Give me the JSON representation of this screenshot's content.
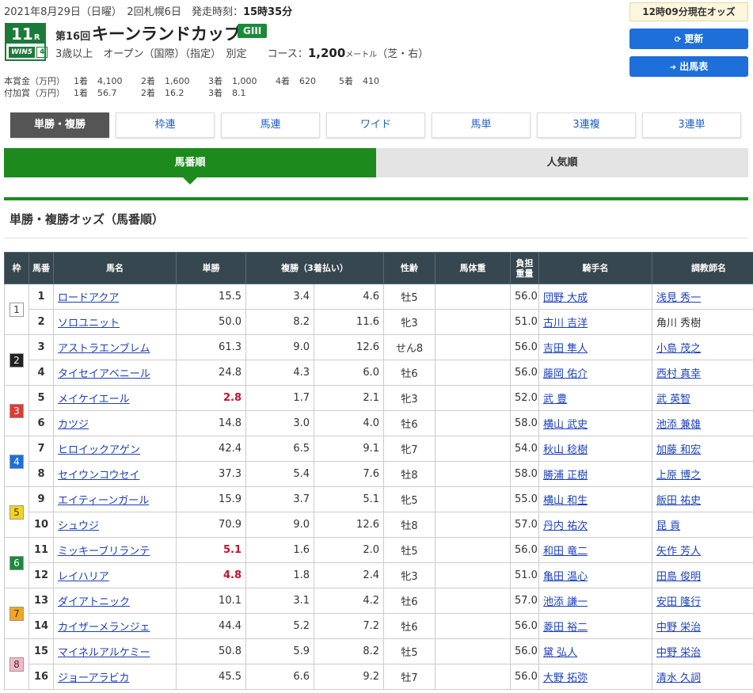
{
  "header": {
    "date_line": "2021年8月29日（日曜）　2回札幌6日　発走時刻：",
    "post_time": "15時35分",
    "race_no": "11",
    "race_no_suffix": "R",
    "win5_label": "WIN5",
    "win5_no": "4",
    "kai": "第16回",
    "race_name": "キーンランドカップ",
    "grade": "GIII",
    "conditions": "3歳以上　オープン（国際）（指定）　別定　　コース：",
    "course_distance": "1,200",
    "course_unit": "メートル",
    "course_detail": "（芝・右）"
  },
  "prize": {
    "main": [
      "本賞金（万円）",
      "1着",
      "4,100",
      "2着",
      "1,600",
      "3着",
      "1,000",
      "4着",
      "620",
      "5着",
      "410"
    ],
    "added": [
      "付加賞（万円）",
      "1着",
      "56.7",
      "2着",
      "16.2",
      "3着",
      "8.1"
    ]
  },
  "right": {
    "odds_time": "12時09分現在オッズ",
    "refresh_label": "更新",
    "refresh_icon": "refresh-icon",
    "entries_label": "出馬表",
    "entries_icon": "arrow-circle-right-icon"
  },
  "tabs": [
    "単勝・複勝",
    "枠連",
    "馬連",
    "ワイド",
    "馬単",
    "3連複",
    "3連単"
  ],
  "segment": {
    "left": "馬番順",
    "right": "人気順"
  },
  "section_title": "単勝・複勝オッズ（馬番順）",
  "table": {
    "headers": {
      "waku": "枠",
      "umaban": "馬番",
      "name": "馬名",
      "win": "単勝",
      "place": "複勝（3着払い）",
      "sex_age": "性齢",
      "weight": "馬体重",
      "burden_1": "負担",
      "burden_2": "重量",
      "jockey": "騎手名",
      "trainer": "調教師名"
    },
    "rows": [
      {
        "waku": "1",
        "umaban": "1",
        "name": "ロードアクア",
        "win": "15.5",
        "pmin": "3.4",
        "pmax": "4.6",
        "sexage": "牡5",
        "burden": "56.0",
        "jockey": "団野 大成",
        "trainer": "浅見 秀一"
      },
      {
        "waku": "",
        "umaban": "2",
        "name": "ソロユニット",
        "win": "50.0",
        "pmin": "8.2",
        "pmax": "11.6",
        "sexage": "牝3",
        "burden": "51.0",
        "jockey": "古川 吉洋",
        "trainer": "角川 秀樹"
      },
      {
        "waku": "2",
        "umaban": "3",
        "name": "アストラエンブレム",
        "win": "61.3",
        "pmin": "9.0",
        "pmax": "12.6",
        "sexage": "せん8",
        "burden": "56.0",
        "jockey": "吉田 隼人",
        "trainer": "小島 茂之"
      },
      {
        "waku": "",
        "umaban": "4",
        "name": "タイセイアベニール",
        "win": "24.8",
        "pmin": "4.3",
        "pmax": "6.0",
        "sexage": "牡6",
        "burden": "56.0",
        "jockey": "藤岡 佑介",
        "trainer": "西村 真幸"
      },
      {
        "waku": "3",
        "umaban": "5",
        "name": "メイケイエール",
        "win": "2.8",
        "pmin": "1.7",
        "pmax": "2.1",
        "sexage": "牝3",
        "burden": "52.0",
        "jockey": "武 豊",
        "trainer": "武 英智"
      },
      {
        "waku": "",
        "umaban": "6",
        "name": "カツジ",
        "win": "14.8",
        "pmin": "3.0",
        "pmax": "4.0",
        "sexage": "牡6",
        "burden": "58.0",
        "jockey": "横山 武史",
        "trainer": "池添 兼雄"
      },
      {
        "waku": "4",
        "umaban": "7",
        "name": "ヒロイックアゲン",
        "win": "42.4",
        "pmin": "6.5",
        "pmax": "9.1",
        "sexage": "牝7",
        "burden": "54.0",
        "jockey": "秋山 稔樹",
        "trainer": "加藤 和宏"
      },
      {
        "waku": "",
        "umaban": "8",
        "name": "セイウンコウセイ",
        "win": "37.3",
        "pmin": "5.4",
        "pmax": "7.6",
        "sexage": "牡8",
        "burden": "58.0",
        "jockey": "勝浦 正樹",
        "trainer": "上原 博之"
      },
      {
        "waku": "5",
        "umaban": "9",
        "name": "エイティーンガール",
        "win": "15.9",
        "pmin": "3.7",
        "pmax": "5.1",
        "sexage": "牝5",
        "burden": "55.0",
        "jockey": "横山 和生",
        "trainer": "飯田 祐史"
      },
      {
        "waku": "",
        "umaban": "10",
        "name": "シュウジ",
        "win": "70.9",
        "pmin": "9.0",
        "pmax": "12.6",
        "sexage": "牡8",
        "burden": "57.0",
        "jockey": "丹内 祐次",
        "trainer": "昆 貢"
      },
      {
        "waku": "6",
        "umaban": "11",
        "name": "ミッキーブリランテ",
        "win": "5.1",
        "pmin": "1.6",
        "pmax": "2.0",
        "sexage": "牡5",
        "burden": "56.0",
        "jockey": "和田 竜二",
        "trainer": "矢作 芳人"
      },
      {
        "waku": "",
        "umaban": "12",
        "name": "レイハリア",
        "win": "4.8",
        "pmin": "1.8",
        "pmax": "2.4",
        "sexage": "牝3",
        "burden": "51.0",
        "jockey": "亀田 温心",
        "trainer": "田島 俊明"
      },
      {
        "waku": "7",
        "umaban": "13",
        "name": "ダイアトニック",
        "win": "10.1",
        "pmin": "3.1",
        "pmax": "4.2",
        "sexage": "牡6",
        "burden": "57.0",
        "jockey": "池添 謙一",
        "trainer": "安田 隆行"
      },
      {
        "waku": "",
        "umaban": "14",
        "name": "カイザーメランジェ",
        "win": "44.4",
        "pmin": "5.2",
        "pmax": "7.2",
        "sexage": "牡6",
        "burden": "56.0",
        "jockey": "菱田 裕二",
        "trainer": "中野 栄治"
      },
      {
        "waku": "8",
        "umaban": "15",
        "name": "マイネルアルケミー",
        "win": "50.8",
        "pmin": "5.9",
        "pmax": "8.2",
        "sexage": "牡5",
        "burden": "56.0",
        "jockey": "黛 弘人",
        "trainer": "中野 栄治"
      },
      {
        "waku": "",
        "umaban": "16",
        "name": "ジョーアラビカ",
        "win": "45.5",
        "pmin": "6.6",
        "pmax": "9.2",
        "sexage": "牡7",
        "burden": "56.0",
        "jockey": "大野 拓弥",
        "trainer": "清水 久詞"
      }
    ],
    "popular_wins": [
      "2.8",
      "5.1",
      "4.8"
    ],
    "plain_trainers": [
      "角川 秀樹"
    ],
    "waku_colors": {
      "1": {
        "bg": "#ffffff",
        "fg": "#333333"
      },
      "2": {
        "bg": "#222222",
        "fg": "#ffffff"
      },
      "3": {
        "bg": "#e03c31",
        "fg": "#ffffff"
      },
      "4": {
        "bg": "#1e6fd9",
        "fg": "#ffffff"
      },
      "5": {
        "bg": "#f7d31e",
        "fg": "#333333"
      },
      "6": {
        "bg": "#1d8a3a",
        "fg": "#ffffff"
      },
      "7": {
        "bg": "#f5a623",
        "fg": "#333333"
      },
      "8": {
        "bg": "#f7b6c8",
        "fg": "#333333"
      }
    }
  }
}
